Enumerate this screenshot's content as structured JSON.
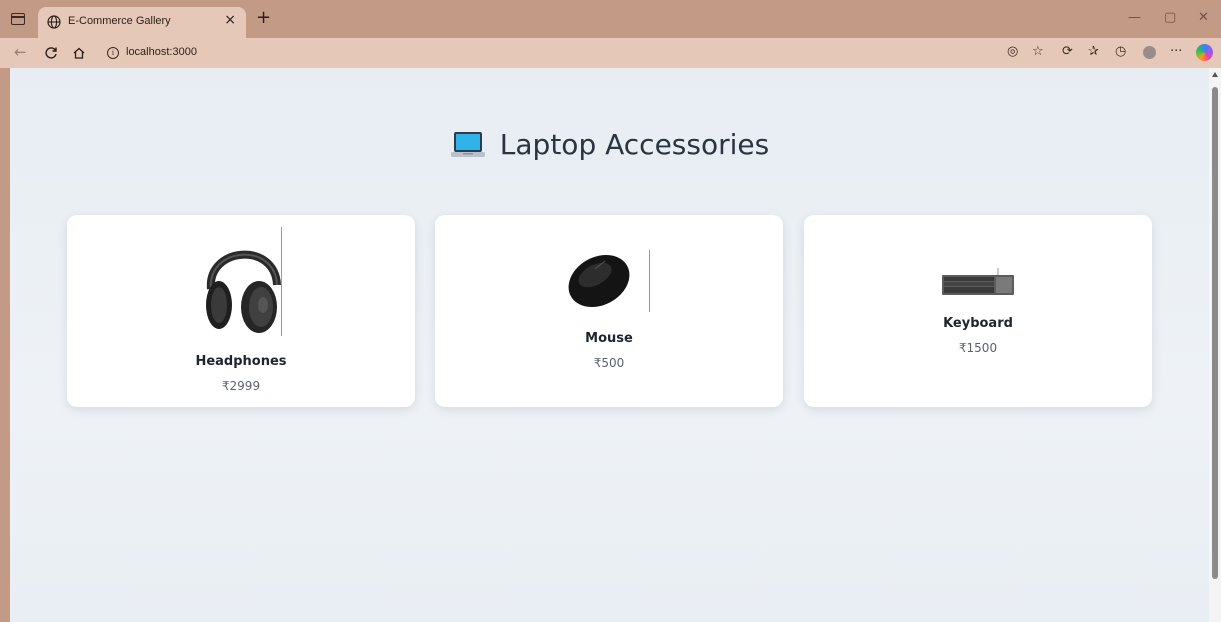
{
  "browser": {
    "tab_title": "E-Commerce Gallery",
    "tab_close": "×",
    "new_tab": "+",
    "url": "localhost:3000",
    "window_controls": {
      "minimize": "—",
      "restore": "▢",
      "close": "✕"
    }
  },
  "page": {
    "title": "Laptop Accessories",
    "title_icon": "laptop-emoji"
  },
  "products": [
    {
      "name": "Headphones",
      "price": "₹2999",
      "image": "headphones-image"
    },
    {
      "name": "Mouse",
      "price": "₹500",
      "image": "mouse-image"
    },
    {
      "name": "Keyboard",
      "price": "₹1500",
      "image": "keyboard-image"
    }
  ]
}
